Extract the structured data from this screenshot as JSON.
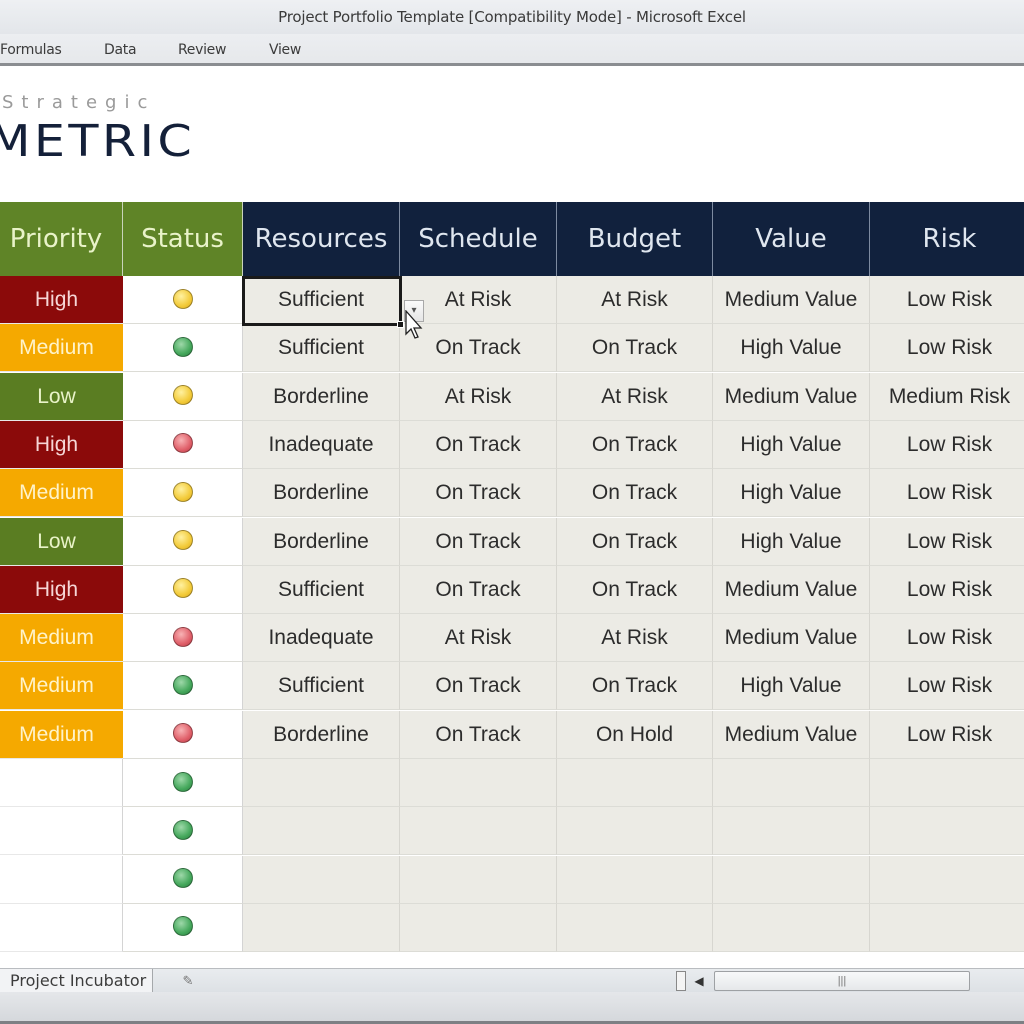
{
  "window": {
    "title": "Project Portfolio Template  [Compatibility Mode]  -  Microsoft Excel"
  },
  "ribbon": {
    "tabs": [
      {
        "label": "Formulas"
      },
      {
        "label": "Data"
      },
      {
        "label": "Review"
      },
      {
        "label": "View"
      }
    ]
  },
  "logo": {
    "top": "Strategic",
    "main": "METRIC"
  },
  "table": {
    "headers": [
      {
        "label": "Priority",
        "group": "green"
      },
      {
        "label": "Status",
        "group": "green"
      },
      {
        "label": "Resources",
        "group": "navy"
      },
      {
        "label": "Schedule",
        "group": "navy"
      },
      {
        "label": "Budget",
        "group": "navy"
      },
      {
        "label": "Value",
        "group": "navy"
      },
      {
        "label": "Risk",
        "group": "navy"
      }
    ],
    "rows": [
      {
        "priority": "High",
        "status": "yellow",
        "resources": "Sufficient",
        "schedule": "At Risk",
        "budget": "At Risk",
        "value": "Medium Value",
        "risk": "Low Risk"
      },
      {
        "priority": "Medium",
        "status": "green",
        "resources": "Sufficient",
        "schedule": "On Track",
        "budget": "On Track",
        "value": "High Value",
        "risk": "Low Risk"
      },
      {
        "priority": "Low",
        "status": "yellow",
        "resources": "Borderline",
        "schedule": "At Risk",
        "budget": "At Risk",
        "value": "Medium Value",
        "risk": "Medium Risk"
      },
      {
        "priority": "High",
        "status": "red",
        "resources": "Inadequate",
        "schedule": "On Track",
        "budget": "On Track",
        "value": "High Value",
        "risk": "Low Risk"
      },
      {
        "priority": "Medium",
        "status": "yellow",
        "resources": "Borderline",
        "schedule": "On Track",
        "budget": "On Track",
        "value": "High Value",
        "risk": "Low Risk"
      },
      {
        "priority": "Low",
        "status": "yellow",
        "resources": "Borderline",
        "schedule": "On Track",
        "budget": "On Track",
        "value": "High Value",
        "risk": "Low Risk"
      },
      {
        "priority": "High",
        "status": "yellow",
        "resources": "Sufficient",
        "schedule": "On Track",
        "budget": "On Track",
        "value": "Medium Value",
        "risk": "Low Risk"
      },
      {
        "priority": "Medium",
        "status": "red",
        "resources": "Inadequate",
        "schedule": "At Risk",
        "budget": "At Risk",
        "value": "Medium Value",
        "risk": "Low Risk"
      },
      {
        "priority": "Medium",
        "status": "green",
        "resources": "Sufficient",
        "schedule": "On Track",
        "budget": "On Track",
        "value": "High Value",
        "risk": "Low Risk"
      },
      {
        "priority": "Medium",
        "status": "red",
        "resources": "Borderline",
        "schedule": "On Track",
        "budget": "On Hold",
        "value": "Medium Value",
        "risk": "Low Risk"
      },
      {
        "priority": "",
        "status": "green",
        "resources": "",
        "schedule": "",
        "budget": "",
        "value": "",
        "risk": ""
      },
      {
        "priority": "",
        "status": "green",
        "resources": "",
        "schedule": "",
        "budget": "",
        "value": "",
        "risk": ""
      },
      {
        "priority": "",
        "status": "green",
        "resources": "",
        "schedule": "",
        "budget": "",
        "value": "",
        "risk": ""
      },
      {
        "priority": "",
        "status": "green",
        "resources": "",
        "schedule": "",
        "budget": "",
        "value": "",
        "risk": ""
      }
    ],
    "selected_cell": {
      "row": 0,
      "column": "resources",
      "value": "Sufficient"
    }
  },
  "colors": {
    "priority_high": "#8b0a0a",
    "priority_medium": "#f5a900",
    "priority_low": "#5a7d22",
    "header_green": "#5f8427",
    "header_navy": "#11213d",
    "status_green": "#45a85c",
    "status_yellow": "#f3cb3a",
    "status_red": "#e0606a"
  },
  "sheet_tabs": [
    {
      "label": "Project Incubator",
      "active": true
    }
  ],
  "icons": {
    "dropdown": "▾",
    "new_sheet": "✎",
    "scroll_left": "◀",
    "scroll_grip": "|||"
  }
}
